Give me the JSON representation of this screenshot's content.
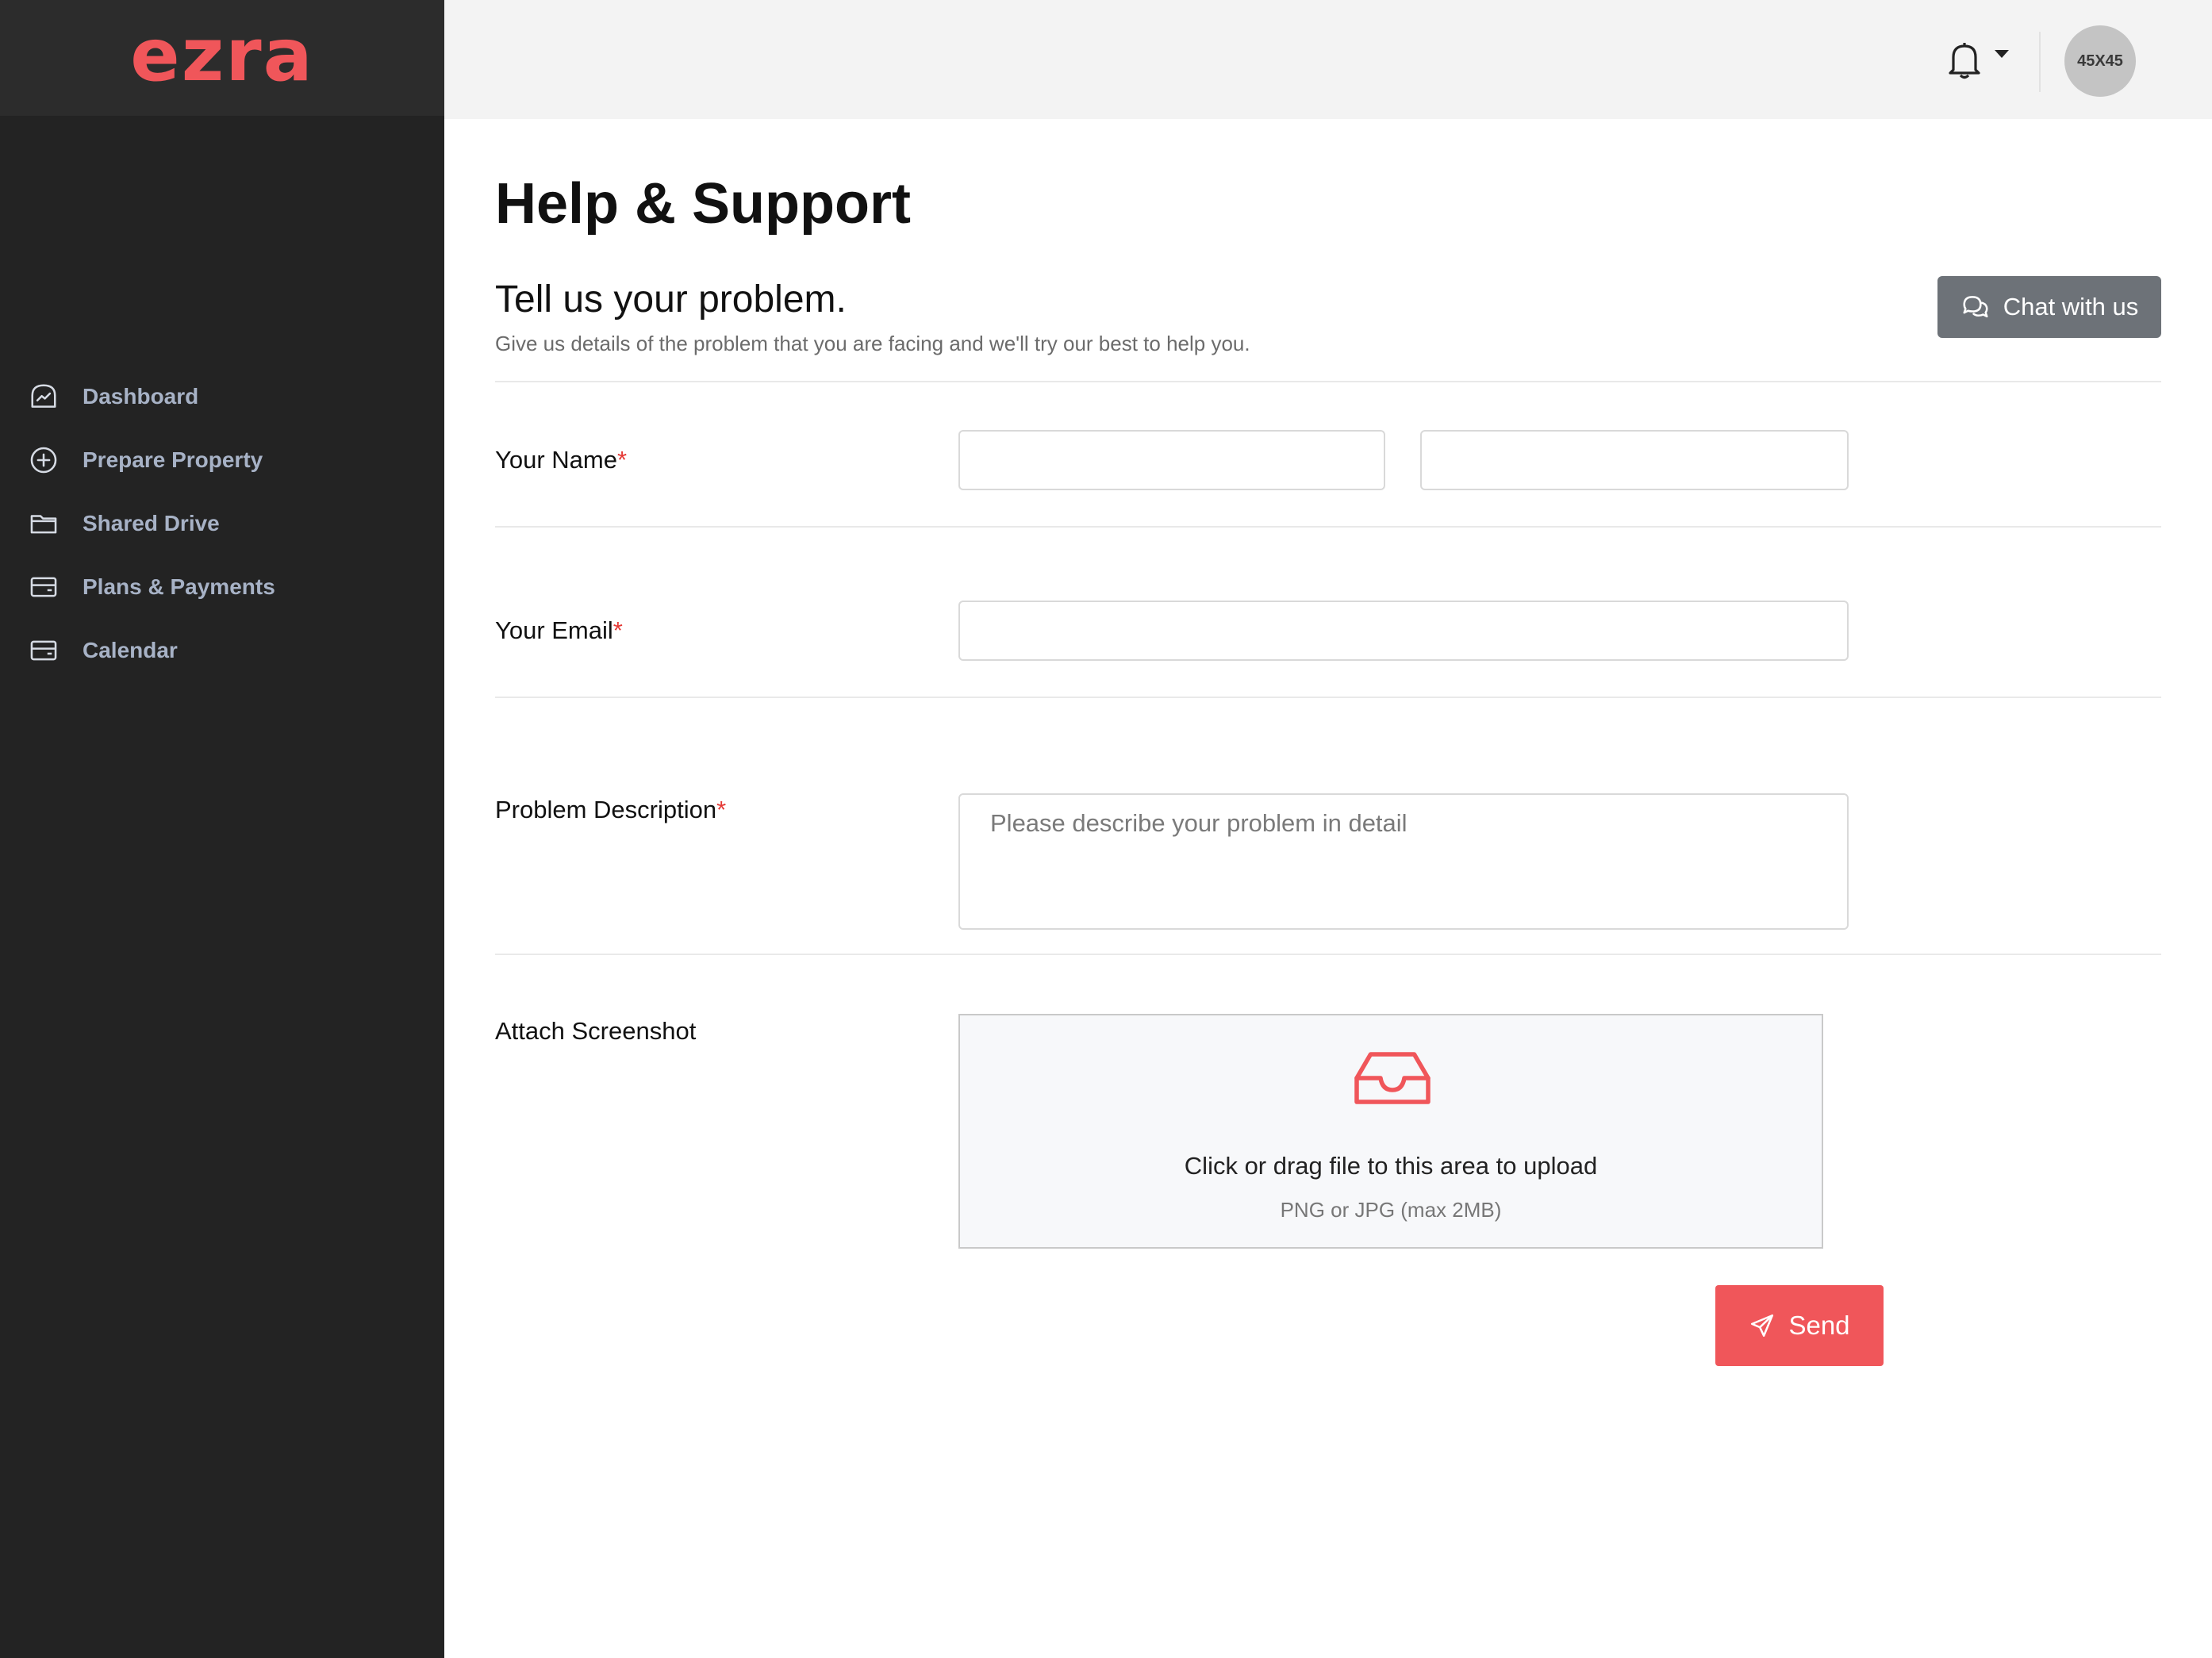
{
  "brand": {
    "logo_text": "ezra",
    "accent_color": "#f0565a"
  },
  "sidebar": {
    "items": [
      {
        "label": "Dashboard",
        "icon": "dashboard-chart-icon"
      },
      {
        "label": "Prepare Property",
        "icon": "plus-circle-icon"
      },
      {
        "label": "Shared Drive",
        "icon": "folder-icon"
      },
      {
        "label": "Plans & Payments",
        "icon": "credit-card-icon"
      },
      {
        "label": "Calendar",
        "icon": "credit-card-icon"
      }
    ]
  },
  "header": {
    "notifications_icon": "bell-icon",
    "avatar_text": "45X45"
  },
  "main": {
    "title": "Help & Support",
    "section_title": "Tell us your problem.",
    "section_subtitle": "Give us details of the problem that you are facing and we'll try our best to help you.",
    "chat_button": "Chat with us",
    "form": {
      "name_label": "Your Name",
      "email_label": "Your Email",
      "description_label": "Problem Description",
      "description_placeholder": "Please describe your problem in detail",
      "required_marker": "*",
      "attach_label": "Attach Screenshot",
      "upload_text": "Click or drag file to this area to upload",
      "upload_hint": "PNG or JPG (max 2MB)",
      "first_name_value": "",
      "last_name_value": "",
      "email_value": ""
    },
    "send_button": "Send"
  }
}
